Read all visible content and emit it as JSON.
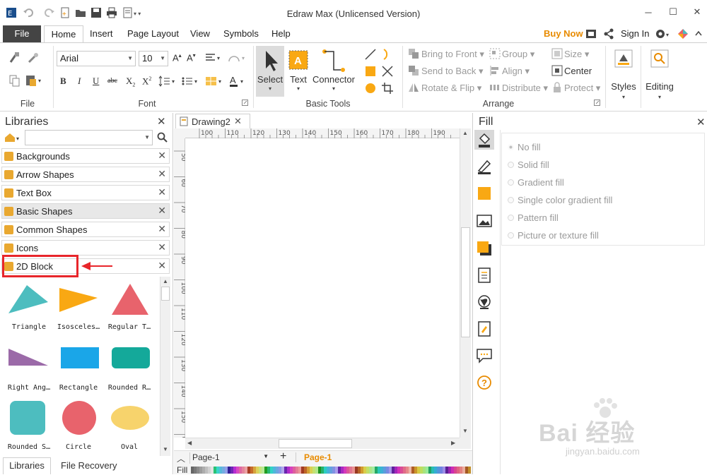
{
  "window": {
    "title": "Edraw Max (Unlicensed Version)",
    "controls": {
      "minimize": "─",
      "maximize": "☐",
      "close": "✕"
    }
  },
  "menu_tabs": [
    "File",
    "Home",
    "Insert",
    "Page Layout",
    "View",
    "Symbols",
    "Help"
  ],
  "top_right": {
    "buy_now": "Buy Now",
    "sign_in": "Sign In"
  },
  "ribbon": {
    "groups": {
      "file": "File",
      "font": "Font",
      "basic_tools": "Basic Tools",
      "arrange": "Arrange"
    },
    "font": {
      "family": "Arial",
      "size": "10"
    },
    "tools": {
      "select": "Select",
      "text": "Text",
      "connector": "Connector"
    },
    "arrange": {
      "bring_to_front": "Bring to Front",
      "send_to_back": "Send to Back",
      "rotate_flip": "Rotate & Flip",
      "group": "Group",
      "align": "Align",
      "distribute": "Distribute",
      "size": "Size",
      "center": "Center",
      "protect": "Protect"
    },
    "styles": "Styles",
    "editing": "Editing"
  },
  "libraries": {
    "title": "Libraries",
    "search_placeholder": "",
    "items": [
      "Backgrounds",
      "Arrow Shapes",
      "Text Box",
      "Basic Shapes",
      "Common Shapes",
      "Icons",
      "2D Block"
    ],
    "shapes": [
      {
        "label": "Triangle",
        "color": "#4dbdbf"
      },
      {
        "label": "Isosceles…",
        "color": "#f9a813"
      },
      {
        "label": "Regular T…",
        "color": "#e8636c"
      },
      {
        "label": "Right Ang…",
        "color": "#9b6aa8"
      },
      {
        "label": "Rectangle",
        "color": "#1aa6e8"
      },
      {
        "label": "Rounded R…",
        "color": "#14a99a"
      },
      {
        "label": "Rounded S…",
        "color": "#4dbdbf"
      },
      {
        "label": "Circle",
        "color": "#e8636c"
      },
      {
        "label": "Oval",
        "color": "#f7d36c"
      }
    ],
    "bottom_tabs": {
      "libraries": "Libraries",
      "file_recovery": "File Recovery"
    }
  },
  "document": {
    "tab": "Drawing2",
    "ruler_h": [
      "100",
      "110",
      "120",
      "130",
      "140",
      "150",
      "160",
      "170",
      "180",
      "190"
    ],
    "ruler_v": [
      "50",
      "60",
      "70",
      "80",
      "90",
      "100",
      "110",
      "120",
      "130",
      "140",
      "150",
      "60"
    ],
    "page_selector": "Page-1",
    "page_tab": "Page-1",
    "fill_label": "Fill"
  },
  "fill_panel": {
    "title": "Fill",
    "options": [
      "No fill",
      "Solid fill",
      "Gradient fill",
      "Single color gradient fill",
      "Pattern fill",
      "Picture or texture fill"
    ]
  },
  "watermark": {
    "text": "Bai 经验",
    "url": "jingyan.baidu.com"
  }
}
